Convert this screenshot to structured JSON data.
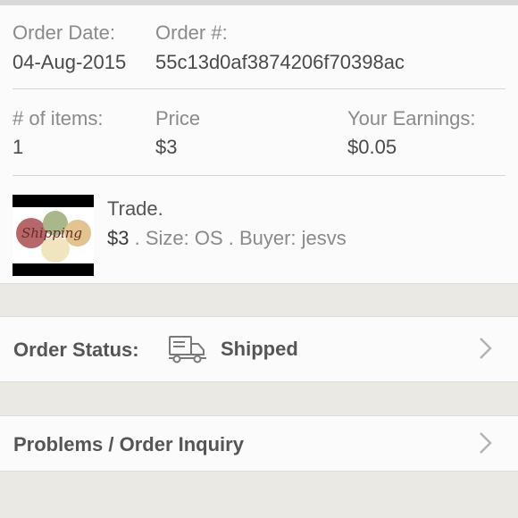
{
  "order": {
    "date_label": "Order Date:",
    "date_value": "04-Aug-2015",
    "number_label": "Order #:",
    "number_value": "55c13d0af3874206f70398ac"
  },
  "summary": {
    "items_label": "# of items:",
    "items_value": "1",
    "price_label": "Price",
    "price_value": "$3",
    "earnings_label": "Your Earnings:",
    "earnings_value": "$0.05"
  },
  "item": {
    "title": "Trade.",
    "price": "$3",
    "meta": " . Size: OS . Buyer: jesvs",
    "image_text": "Shipping",
    "image_icon": "shipping-listing-image"
  },
  "status_row": {
    "label": "Order Status:",
    "icon": "truck-icon",
    "value": "Shipped",
    "chevron": "chevron-right-icon"
  },
  "inquiry_row": {
    "label": "Problems / Order Inquiry",
    "chevron": "chevron-right-icon"
  },
  "colors": {
    "background": "#ebe9e4",
    "card": "#fbfbfb",
    "label_gray": "#8a8a8a",
    "text_dark": "#4a4a4a"
  }
}
